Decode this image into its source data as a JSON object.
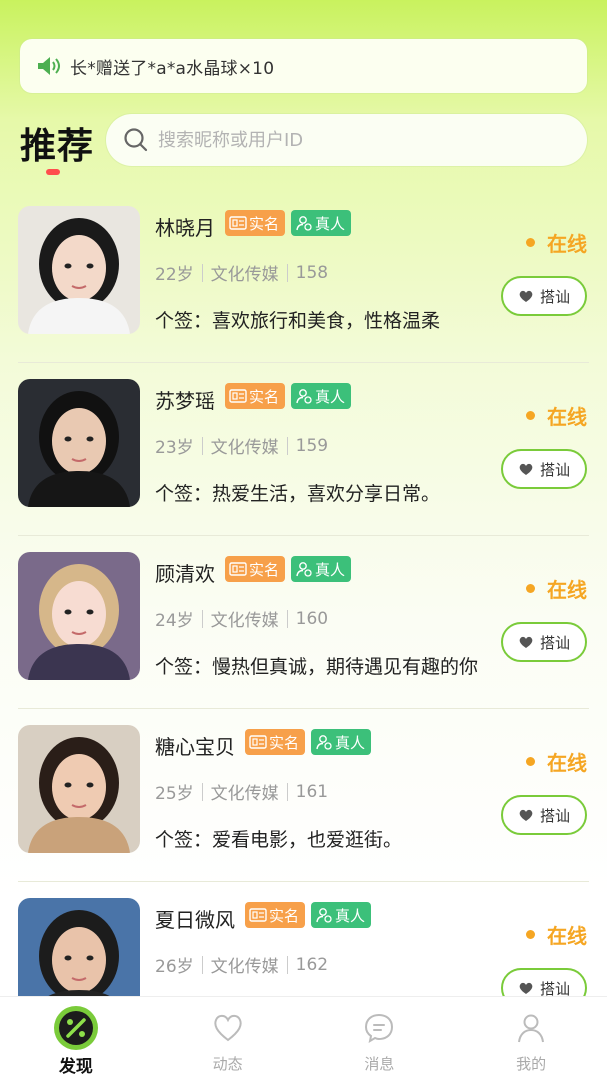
{
  "notice": {
    "text": "长*赠送了*a*a水晶球×10",
    "icon": "speaker-icon"
  },
  "header": {
    "title": "推荐",
    "search_placeholder": "搜索昵称或用户ID"
  },
  "badges": {
    "realname": "实名",
    "realperson": "真人"
  },
  "status_label": "在线",
  "chat_label": "搭讪",
  "users": [
    {
      "name": "林晓月",
      "age": "22岁",
      "industry": "文化传媒",
      "height": "158",
      "sign": "个签：喜欢旅行和美食，性格温柔"
    },
    {
      "name": "苏梦瑶",
      "age": "23岁",
      "industry": "文化传媒",
      "height": "159",
      "sign": "个签：热爱生活，喜欢分享日常。"
    },
    {
      "name": "顾清欢",
      "age": "24岁",
      "industry": "文化传媒",
      "height": "160",
      "sign": "个签：慢热但真诚，期待遇见有趣的你"
    },
    {
      "name": "糖心宝贝",
      "age": "25岁",
      "industry": "文化传媒",
      "height": "161",
      "sign": "个签：爱看电影，也爱逛街。"
    },
    {
      "name": "夏日微风",
      "age": "26岁",
      "industry": "文化传媒",
      "height": "162",
      "sign": ""
    }
  ],
  "tabbar": [
    {
      "label": "发现",
      "icon": "discover-icon",
      "active": true
    },
    {
      "label": "动态",
      "icon": "heart-icon",
      "active": false
    },
    {
      "label": "消息",
      "icon": "message-icon",
      "active": false
    },
    {
      "label": "我的",
      "icon": "profile-icon",
      "active": false
    }
  ],
  "colors": {
    "accent": "#7acb3a",
    "online": "#f5a623",
    "realname_badge": "#f7a04a",
    "realperson_badge": "#3cc07a"
  }
}
